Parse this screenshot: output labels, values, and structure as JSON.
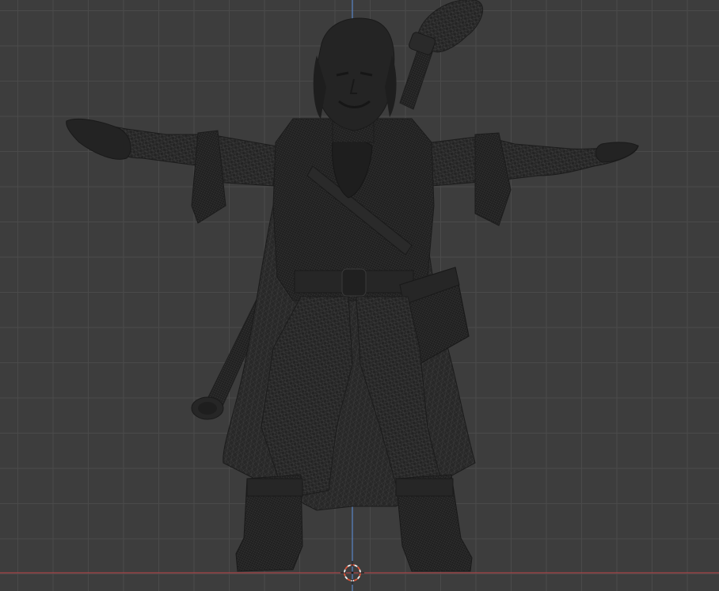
{
  "app": {
    "view": "3d-viewport"
  },
  "colors": {
    "background": "#3d3d3d",
    "grid_line": "#4a4a4a",
    "x_axis": "#a8454a",
    "z_axis": "#5b86c8",
    "mesh_fill": "#222222",
    "mesh_wire": "#3a3a3a",
    "mesh_shade": "#1c1c1c",
    "cursor_red": "#e0573c",
    "cursor_white": "#f0f0f0"
  },
  "icons": {
    "cursor": "3d-cursor-icon"
  },
  "viewport": {
    "mode": "wireframe",
    "object": "character-mesh",
    "pose": "t-pose"
  }
}
